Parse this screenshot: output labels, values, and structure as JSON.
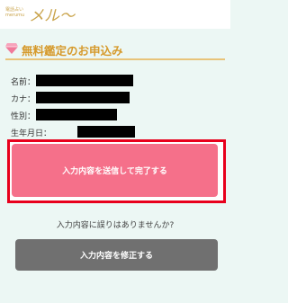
{
  "header": {
    "logo_small": "電話占い\nmerumu",
    "logo_main": "メル〜"
  },
  "section": {
    "title": "無料鑑定のお申込み",
    "icon": "gem-icon",
    "accent_color": "#d69a2c"
  },
  "form": {
    "fields": [
      {
        "label": "名前："
      },
      {
        "label": "カナ："
      },
      {
        "label": "性別："
      },
      {
        "label": "生年月日："
      }
    ]
  },
  "actions": {
    "submit_label": "入力内容を送信して完了する",
    "submit_color": "#f5708a",
    "highlight_color": "#e8001c",
    "question": "入力内容に誤りはありませんか?",
    "edit_label": "入力内容を修正する",
    "edit_color": "#707070"
  }
}
